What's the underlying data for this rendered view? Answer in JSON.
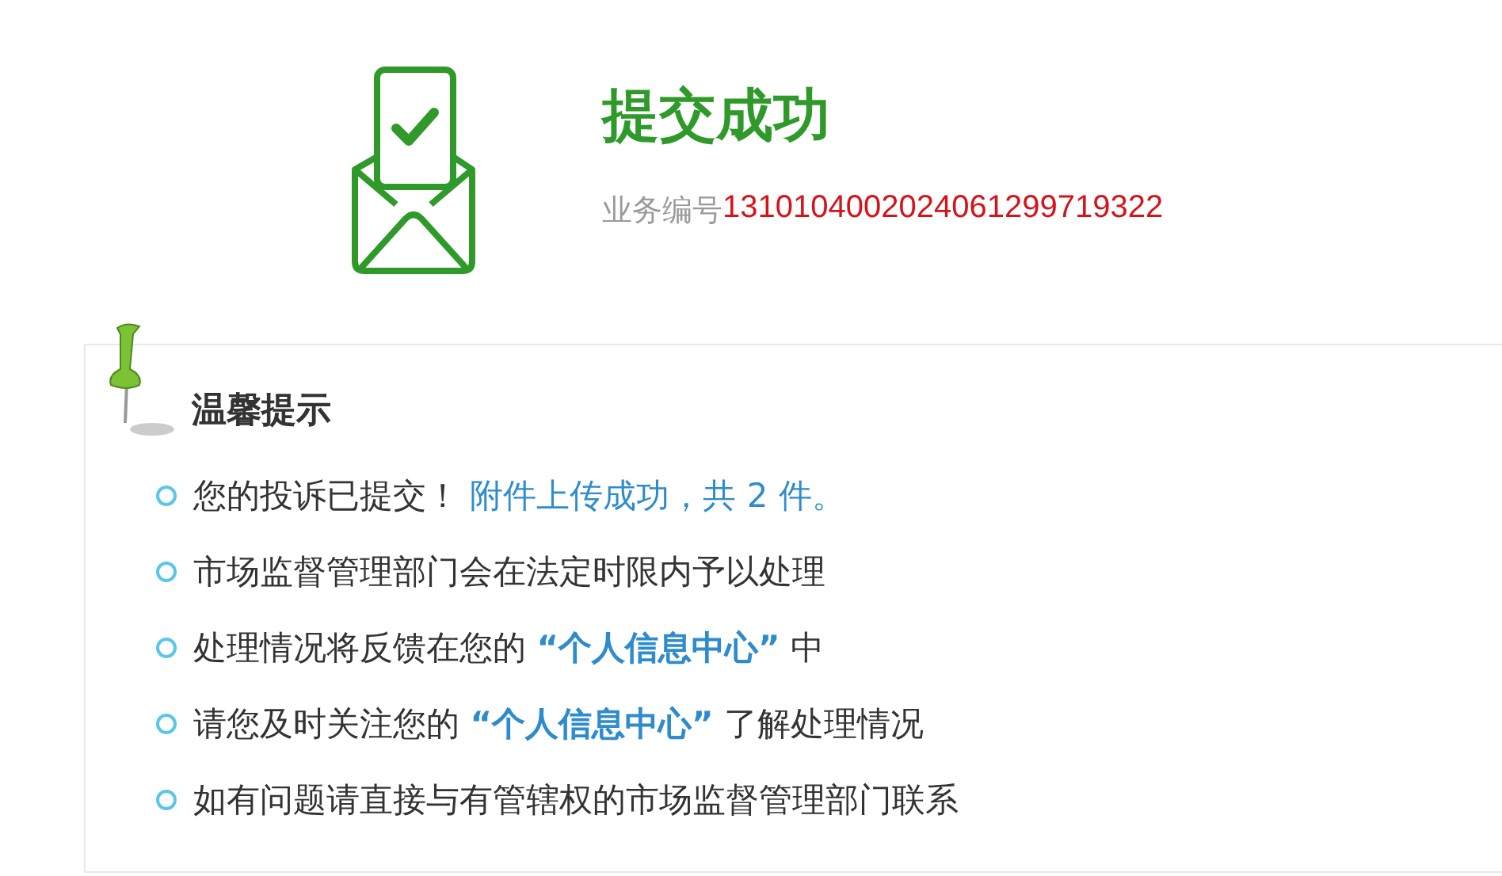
{
  "result": {
    "title": "提交成功",
    "number_label": "业务编号",
    "number": "1310104002024061299719322"
  },
  "tips": {
    "heading": "温馨提示",
    "items": [
      {
        "parts": [
          {
            "text": "您的投诉已提交！ ",
            "kind": "plain"
          },
          {
            "text": "附件上传成功，共 2 件。",
            "kind": "accent"
          }
        ]
      },
      {
        "parts": [
          {
            "text": "市场监督管理部门会在法定时限内予以处理",
            "kind": "plain"
          }
        ]
      },
      {
        "parts": [
          {
            "text": "处理情况将反馈在您的 ",
            "kind": "plain"
          },
          {
            "text": "“个人信息中心”",
            "kind": "emphasis"
          },
          {
            "text": " 中",
            "kind": "plain"
          }
        ]
      },
      {
        "parts": [
          {
            "text": "请您及时关注您的 ",
            "kind": "plain"
          },
          {
            "text": "“个人信息中心”",
            "kind": "emphasis"
          },
          {
            "text": " 了解处理情况",
            "kind": "plain"
          }
        ]
      },
      {
        "parts": [
          {
            "text": "如有问题请直接与有管辖权的市场监督管理部门联系",
            "kind": "plain"
          }
        ]
      }
    ]
  }
}
